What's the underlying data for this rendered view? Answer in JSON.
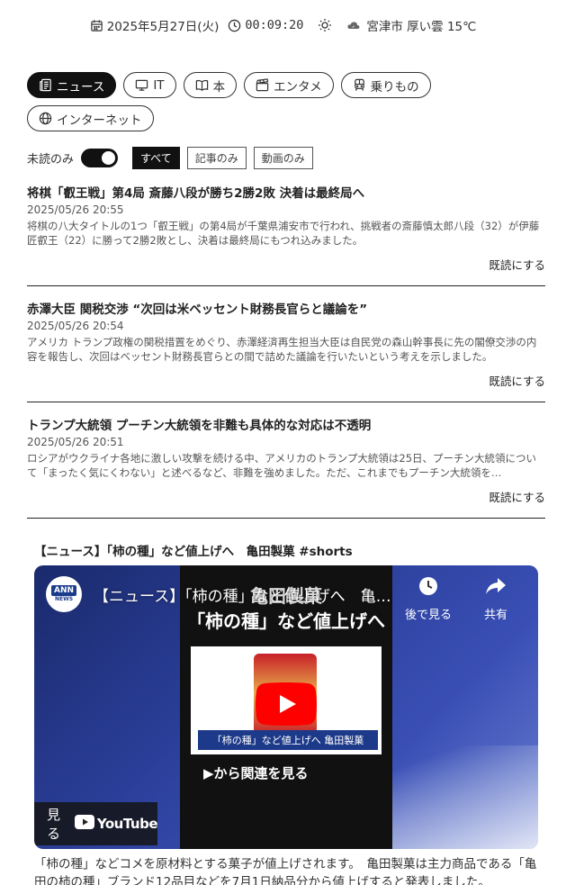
{
  "header": {
    "date": "2025年5月27日(火)",
    "time": "00:09:20",
    "weather": "宮津市 厚い雲 15℃"
  },
  "tabs": [
    {
      "label": "ニュース",
      "icon": "newspaper-icon",
      "active": true
    },
    {
      "label": "IT",
      "icon": "monitor-icon",
      "active": false
    },
    {
      "label": "本",
      "icon": "book-icon",
      "active": false
    },
    {
      "label": "エンタメ",
      "icon": "clapperboard-icon",
      "active": false
    },
    {
      "label": "乗りもの",
      "icon": "train-icon",
      "active": false
    },
    {
      "label": "インターネット",
      "icon": "globe-icon",
      "active": false
    }
  ],
  "filters": {
    "unread_label": "未読のみ",
    "unread_on": true,
    "buttons": [
      {
        "label": "すべて",
        "active": true
      },
      {
        "label": "記事のみ",
        "active": false
      },
      {
        "label": "動画のみ",
        "active": false
      }
    ]
  },
  "articles": [
    {
      "title": "将棋「叡王戦」第4局 斎藤八段が勝ち2勝2敗 決着は最終局へ",
      "date": "2025/05/26 20:55",
      "summary": "将棋の八大タイトルの1つ「叡王戦」の第4局が千葉県浦安市で行われ、挑戦者の斎藤慎太郎八段（32）が伊藤匠叡王（22）に勝って2勝2敗とし、決着は最終局にもつれ込みました。",
      "mark_read": "既読にする"
    },
    {
      "title": "赤澤大臣 関税交渉 “次回は米ベッセント財務長官らと議論を”",
      "date": "2025/05/26 20:54",
      "summary": "アメリカ トランプ政権の関税措置をめぐり、赤澤経済再生担当大臣は自民党の森山幹事長に先の閣僚交渉の内容を報告し、次回はベッセント財務長官らとの間で詰めた議論を行いたいという考えを示しました。",
      "mark_read": "既読にする"
    },
    {
      "title": "トランプ大統領 プーチン大統領を非難も具体的な対応は不透明",
      "date": "2025/05/26 20:51",
      "summary": "ロシアがウクライナ各地に激しい攻撃を続ける中、アメリカのトランプ大統領は25日、プーチン大統領について「まったく気にくわない」と述べるなど、非難を強めました。ただ、これまでもプーチン大統領を…",
      "mark_read": "既読にする"
    }
  ],
  "video": {
    "heading": "【ニュース】「柿の種」など値上げへ　亀田製菓 #shorts",
    "player_title": "【ニュース】「柿の種」など値上げへ　亀田製菓 #shorts",
    "channel_logo_top": "ANN",
    "channel_logo_bottom": "NEWS",
    "inner_title_top": "亀田製菓",
    "inner_title_bottom": "「柿の種」など値上げへ",
    "inner_caption": "「柿の種」など値上げへ 亀田製菓",
    "inner_related": "▶から関連を見る",
    "watch_later": "後で見る",
    "share": "共有",
    "watch_on": "見る",
    "youtube": "YouTube",
    "description": "「柿の種」などコメを原材料とする菓子が値上げされます。　亀田製菓は主力商品である「亀田の柿の種」ブランド12品目などを7月1日納品分から値上げすると発表しました。"
  }
}
